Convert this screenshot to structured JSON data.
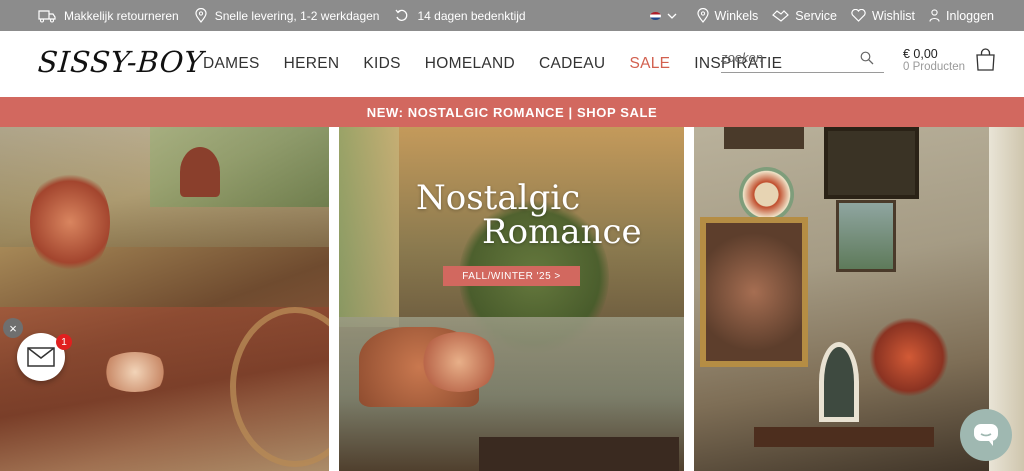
{
  "topbar": {
    "usps": [
      {
        "icon": "truck-icon",
        "label": "Makkelijk retourneren"
      },
      {
        "icon": "location-pin-icon",
        "label": "Snelle levering, 1-2 werkdagen"
      },
      {
        "icon": "return-arrow-icon",
        "label": "14 dagen bedenktijd"
      }
    ],
    "links": {
      "stores": "Winkels",
      "service": "Service",
      "wishlist": "Wishlist",
      "login": "Inloggen"
    }
  },
  "header": {
    "logo": "SISSY-BOY",
    "nav": [
      "DAMES",
      "HEREN",
      "KIDS",
      "HOMELAND",
      "CADEAU",
      "SALE",
      "INSPIRATIE"
    ],
    "search_placeholder": "zoeken",
    "cart_amount": "€ 0,00",
    "cart_count": "0 Producten"
  },
  "promo": {
    "text": "NEW: NOSTALGIC ROMANCE | SHOP SALE"
  },
  "hero": {
    "title_line1": "Nostalgic",
    "title_line2": "Romance",
    "button": "FALL/WINTER '25 >"
  },
  "widgets": {
    "close": "×",
    "mail_badge": "1"
  },
  "colors": {
    "topbar": "#8c8c8c",
    "accent": "#d2685f",
    "sale": "#d2604f",
    "chat": "#9fb8b1"
  }
}
